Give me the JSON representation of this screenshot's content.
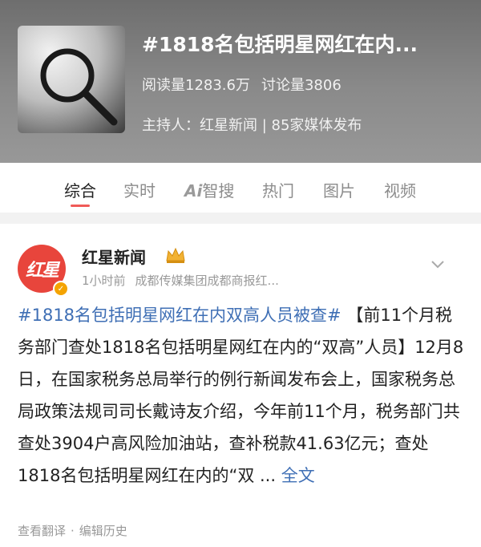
{
  "topic": {
    "title": "#1818名包括明星网红在内...",
    "read_count": "阅读量1283.6万",
    "discussion_count": "讨论量3806",
    "host": "主持人：红星新闻 | 85家媒体发布"
  },
  "tabs": [
    {
      "label": "综合",
      "active": true
    },
    {
      "label": "实时",
      "active": false
    },
    {
      "label": "智搜",
      "badge": "Ai",
      "active": false
    },
    {
      "label": "热门",
      "active": false
    },
    {
      "label": "图片",
      "active": false
    },
    {
      "label": "视频",
      "active": false
    }
  ],
  "post": {
    "avatar_text": "红星",
    "author": "红星新闻",
    "time": "1小时前",
    "source": "成都传媒集团成都商报红...",
    "hashtag": "#1818名包括明星网红在内双高人员被查#",
    "body": "【前11个月税务部门查处1818名包括明星网红在内的“双高”人员】12月8日，在国家税务总局举行的例行新闻发布会上，国家税务总局政策法规司司长戴诗友介绍，今年前11个月，税务部门共查处3904户高风险加油站，查补税款41.63亿元；查处1818名包括明星网红在内的“双 ...",
    "expand_label": "全文",
    "footer": {
      "translate": "查看翻译",
      "separator": "·",
      "history": "编辑历史"
    }
  },
  "colors": {
    "accent": "#f05a57",
    "link": "#3f6fb5",
    "avatar": "#e8453c"
  },
  "icons": [
    "magnifier-thumbnail",
    "crown-icon",
    "verified-icon",
    "chevron-down-icon"
  ]
}
